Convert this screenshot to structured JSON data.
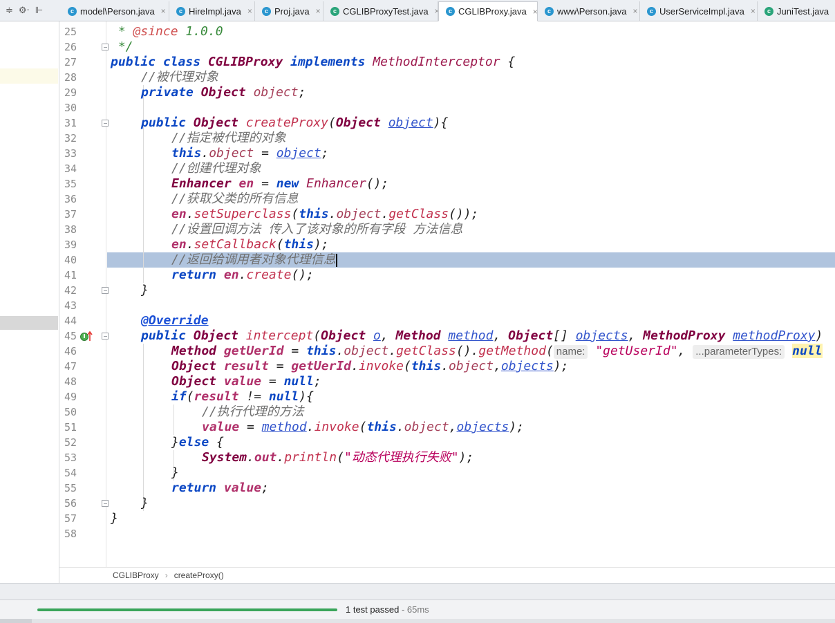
{
  "tabbar": {
    "tools": [
      "≑",
      "⚙·",
      "⊩"
    ],
    "tabs": [
      {
        "label": "model\\Person.java",
        "icon": "c",
        "active": false
      },
      {
        "label": "HireImpl.java",
        "icon": "c",
        "active": false
      },
      {
        "label": "Proj.java",
        "icon": "c",
        "active": false
      },
      {
        "label": "CGLIBProxyTest.java",
        "icon": "c",
        "active": false
      },
      {
        "label": "CGLIBProxy.java",
        "icon": "c",
        "active": true
      },
      {
        "label": "www\\Person.java",
        "icon": "c",
        "active": false
      },
      {
        "label": "UserServiceImpl.java",
        "icon": "c",
        "active": false
      },
      {
        "label": "JuniTest.java",
        "icon": "c",
        "active": false
      }
    ]
  },
  "editor": {
    "line_numbers": [
      "25",
      "26",
      "27",
      "28",
      "29",
      "30",
      "31",
      "32",
      "33",
      "34",
      "35",
      "36",
      "37",
      "38",
      "39",
      "40",
      "41",
      "42",
      "43",
      "44",
      "45",
      "46",
      "47",
      "48",
      "49",
      "50",
      "51",
      "52",
      "53",
      "54",
      "55",
      "56",
      "57",
      "58"
    ],
    "current_line": "40",
    "tokens": {
      "l25_star": " * ",
      "l25_tag": "@since",
      "l25_ver": " 1.0.0",
      "l26": " */",
      "l27_public": "public",
      "l27_class": "class",
      "l27_name": "CGLIBProxy",
      "l27_impl": "implements",
      "l27_iface": "MethodInterceptor",
      "l27_brace": " {",
      "l28": "//被代理对象",
      "l29_private": "private",
      "l29_type": "Object",
      "l29_field": "object",
      "l29_semi": ";",
      "l31_public": "public",
      "l31_type": "Object",
      "l31_method": "createProxy",
      "l31_paren": "(",
      "l31_ptype": "Object",
      "l31_param": "object",
      "l31_end": "){",
      "l32": "//指定被代理的对象",
      "l33_this": "this",
      "l33_dot": ".",
      "l33_field": "object",
      "l33_eq": " = ",
      "l33_param": "object",
      "l33_semi": ";",
      "l34": "//创建代理对象",
      "l35_type": "Enhancer",
      "l35_var": "en",
      "l35_eq": " = ",
      "l35_new": "new",
      "l35_ctor": "Enhancer",
      "l35_end": "();",
      "l36": "//获取父类的所有信息",
      "l37_var": "en",
      "l37_dot": ".",
      "l37_method": "setSuperclass",
      "l37_paren": "(",
      "l37_this": "this",
      "l37_dot2": ".",
      "l37_field": "object",
      "l37_dot3": ".",
      "l37_call": "getClass",
      "l37_end": "());",
      "l38": "//设置回调方法 传入了该对象的所有字段 方法信息",
      "l39_var": "en",
      "l39_dot": ".",
      "l39_method": "setCallback",
      "l39_paren": "(",
      "l39_this": "this",
      "l39_end": ");",
      "l40": "//返回给调用者对象代理信息",
      "l41_return": "return",
      "l41_var": "en",
      "l41_dot": ".",
      "l41_method": "create",
      "l41_end": "();",
      "l42": "}",
      "l44": "@Override",
      "l45_public": "public",
      "l45_type": "Object",
      "l45_method": "intercept",
      "l45_paren": "(",
      "l45_t1": "Object",
      "l45_p1": "o",
      "l45_c1": ", ",
      "l45_t2": "Method",
      "l45_p2": "method",
      "l45_c2": ", ",
      "l45_t3": "Object",
      "l45_arr": "[] ",
      "l45_p3": "objects",
      "l45_c3": ", ",
      "l45_t4": "MethodProxy",
      "l45_p4": "methodProxy",
      "l45_end": ")",
      "l46_type": "Method",
      "l46_var": "getUerId",
      "l46_eq": " = ",
      "l46_this": "this",
      "l46_dot": ".",
      "l46_field": "object",
      "l46_dot2": ".",
      "l46_call": "getClass",
      "l46_mid": "().",
      "l46_call2": "getMethod",
      "l46_paren": "(",
      "l46_hint1": "name:",
      "l46_str": "\"getUserId\"",
      "l46_comma": ", ",
      "l46_hint2": "...parameterTypes:",
      "l46_null": "null",
      "l47_type": "Object",
      "l47_var": "result",
      "l47_eq": " = ",
      "l47_recv": "getUerId",
      "l47_dot": ".",
      "l47_call": "invoke",
      "l47_paren": "(",
      "l47_this": "this",
      "l47_dot2": ".",
      "l47_field": "object",
      "l47_comma": ",",
      "l47_param": "objects",
      "l47_end": ");",
      "l48_type": "Object",
      "l48_var": "value",
      "l48_eq": " = ",
      "l48_null": "null",
      "l48_semi": ";",
      "l49_if": "if",
      "l49_paren": "(",
      "l49_var": "result",
      "l49_ne": " != ",
      "l49_null": "null",
      "l49_end": "){",
      "l50": "//执行代理的方法",
      "l51_var": "value",
      "l51_eq": " = ",
      "l51_param": "method",
      "l51_dot": ".",
      "l51_call": "invoke",
      "l51_paren": "(",
      "l51_this": "this",
      "l51_dot2": ".",
      "l51_field": "object",
      "l51_comma": ",",
      "l51_param2": "objects",
      "l51_end": ");",
      "l52_close": "}",
      "l52_else": "else",
      "l52_brace": " {",
      "l53_sys": "System",
      "l53_dot": ".",
      "l53_out": "out",
      "l53_dot2": ".",
      "l53_call": "println",
      "l53_paren": "(",
      "l53_str": "\"动态代理执行失败\"",
      "l53_end": ");",
      "l54": "}",
      "l55_return": "return",
      "l55_var": "value",
      "l55_semi": ";",
      "l56": "}",
      "l57": "}"
    }
  },
  "breadcrumb": {
    "items": [
      "CGLIBProxy",
      "createProxy()"
    ],
    "separator": "›"
  },
  "status": {
    "message": "1 test passed",
    "duration": " - 65ms",
    "progress": 1.0
  },
  "colors": {
    "keyword": "#0b47c4",
    "type": "#800040",
    "comment": "#707070",
    "string": "#b8005c",
    "caret_row": "#b0c4de",
    "progress": "#3aa55a"
  }
}
